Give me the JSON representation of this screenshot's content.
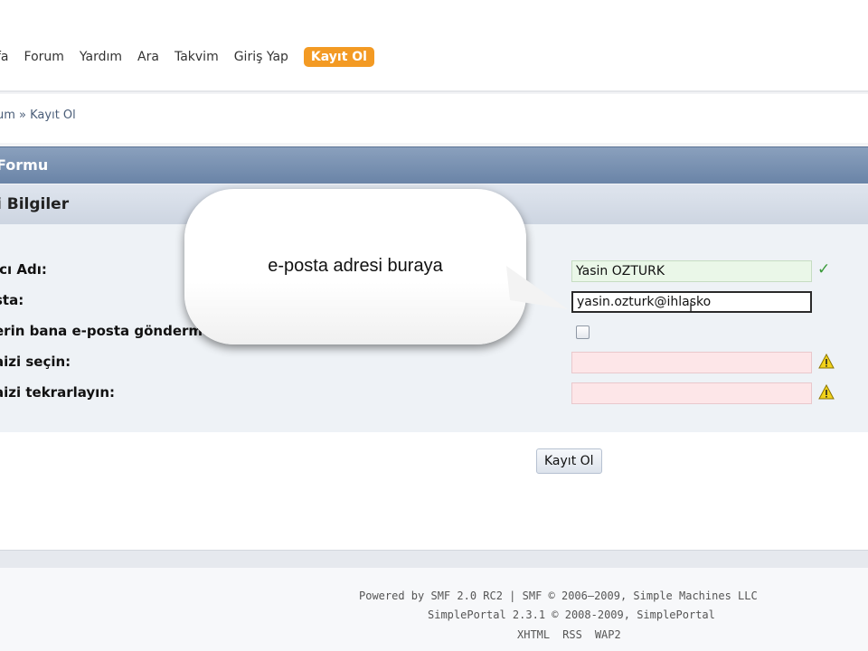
{
  "nav": {
    "items": [
      {
        "label": "fa"
      },
      {
        "label": "Forum"
      },
      {
        "label": "Yardım"
      },
      {
        "label": "Ara"
      },
      {
        "label": "Takvim"
      },
      {
        "label": "Giriş Yap"
      },
      {
        "label": "Kayıt Ol"
      }
    ],
    "accent": "#f39a23"
  },
  "breadcrumb": {
    "text": "um » Kayıt Ol"
  },
  "category": {
    "title": "Formu"
  },
  "section": {
    "title": "i Bilgiler"
  },
  "form": {
    "fields": [
      {
        "label": "ıcı Adı:",
        "value": "Yasin ÖZTÜRK",
        "state": "valid",
        "icon": "check-icon"
      },
      {
        "label": "sta:",
        "value": "yasin.ozturk@ihlasko",
        "state": "focused"
      },
      {
        "label": "erin bana e-posta göndermes",
        "type": "checkbox",
        "checked": false
      },
      {
        "label": "aizi seçin:",
        "value": "",
        "state": "invalid",
        "icon": "warning-icon"
      },
      {
        "label": "aizi tekrarlayın:",
        "value": "",
        "state": "invalid",
        "icon": "warning-icon"
      }
    ],
    "submit_label": "Kayıt Ol"
  },
  "callout": {
    "text": "e-posta adresi buraya"
  },
  "footer": {
    "line1": "Powered by SMF 2.0 RC2 | SMF © 2006–2009, Simple Machines LLC",
    "line2": "SimplePortal 2.3.1 © 2008-2009, SimplePortal",
    "links": [
      "XHTML",
      "RSS",
      "WAP2"
    ]
  }
}
